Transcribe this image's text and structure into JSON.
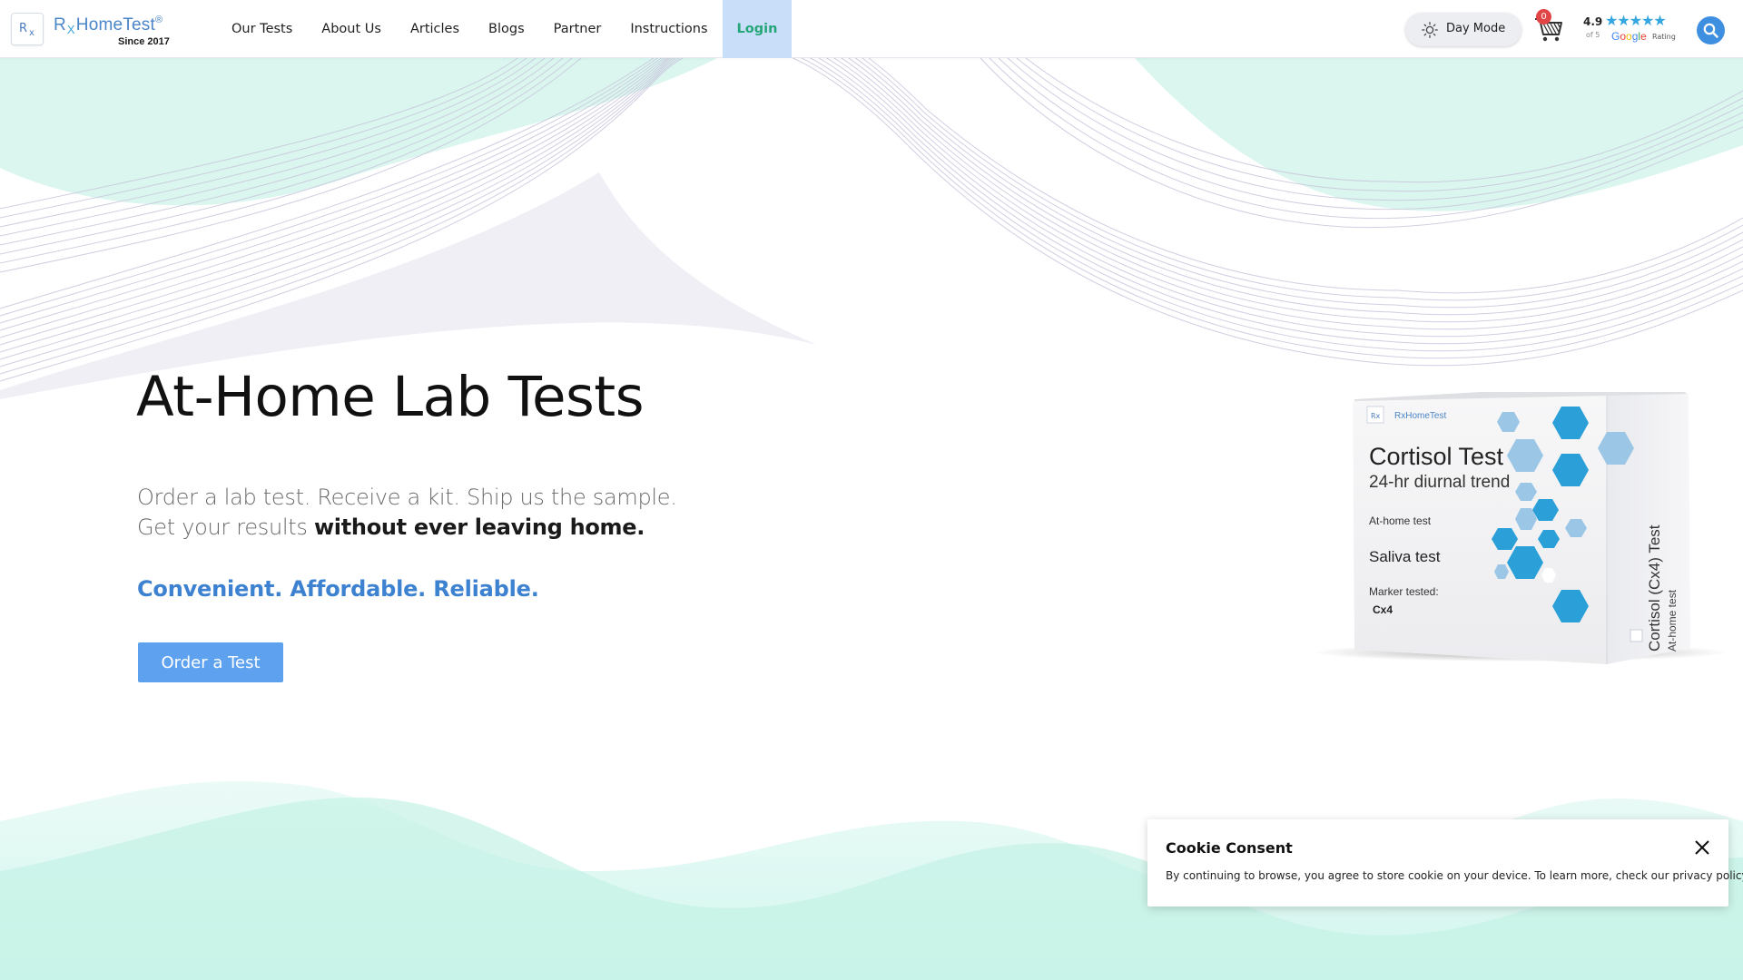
{
  "header": {
    "logo": {
      "prefix": "R",
      "sub": "X",
      "name": "HomeTest",
      "reg": "®",
      "since": "Since 2017",
      "box_r": "R",
      "box_x": "x"
    },
    "nav": [
      {
        "label": "Our Tests"
      },
      {
        "label": "About Us"
      },
      {
        "label": "Articles"
      },
      {
        "label": "Blogs"
      },
      {
        "label": "Partner"
      },
      {
        "label": "Instructions"
      },
      {
        "label": "Login"
      }
    ],
    "day_mode": {
      "label": "Day Mode",
      "icon": "sun-icon"
    },
    "cart": {
      "count": "0",
      "icon": "cart-icon"
    },
    "rating": {
      "score": "4.9",
      "of": "of 5",
      "stars": "★★★★★",
      "provider": "Google",
      "label": "Rating"
    },
    "search": {
      "icon": "search-icon"
    }
  },
  "hero": {
    "title": "At-Home Lab Tests",
    "line1": "Order a lab test. Receive a kit. Ship us the sample.",
    "line2_plain": "Get your results ",
    "line2_strong": "without ever leaving home.",
    "tagline": "Convenient. Affordable. Reliable.",
    "cta": "Order a Test"
  },
  "product": {
    "brand": "RxHomeTest",
    "title": "Cortisol Test",
    "subtitle": "24-hr diurnal trend",
    "type": "At-home test",
    "sample": "Saliva test",
    "marker_label": "Marker tested:",
    "marker": "Cx4",
    "side_title": "Cortisol (Cx4) Test",
    "side_sub": "At-home test"
  },
  "cookie": {
    "title": "Cookie Consent",
    "text": "By continuing to browse, you agree to store cookie on your device. To learn more, check our privacy policy."
  },
  "colors": {
    "accent": "#3d82d1",
    "button": "#5da1ef",
    "login_bg": "#c9def8",
    "login_text": "#25a678",
    "mint": "#d6f6ef",
    "hex_blue": "#2a9fd8"
  }
}
